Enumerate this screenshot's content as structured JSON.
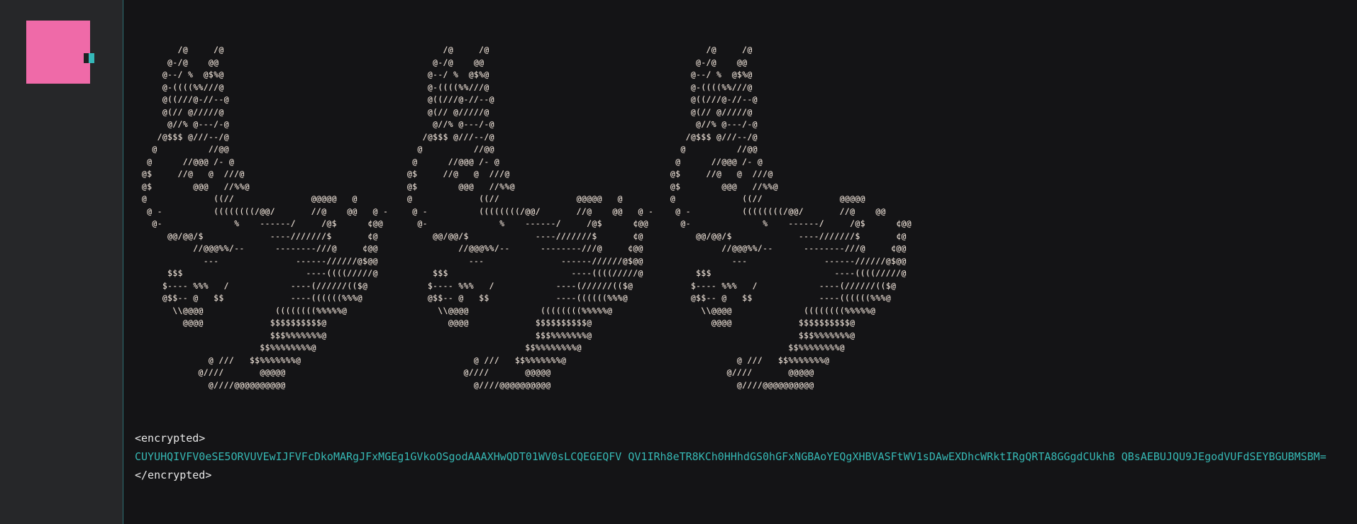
{
  "sidebar": {
    "avatar_color": "#ef6aa8",
    "accent_color": "#35b8b8"
  },
  "art": {
    "copies": [
      "       /@     /@\n     @-/@    @@\n    @--/ %  @$%@\n    @-((((%%///@\n    @((///@-//--@\n    @(// @/////@\n     @//% @---/-@\n   /@$$$ @///--/@\n  @          //@@\n @      //@@@ /- @\n@$     //@   @  ///@\n@$        @@@   //%%@\n@             ((//               @@@@@   @\n @ -          ((((((((/@@/       //@    @@   @ -\n  @-              %    ------/     /@$      ¢@@\n     @@/@@/$             ----///////$       ¢@\n          //@@@%%/--      --------///@     ¢@@\n            ---               ------//////@$@@\n     $$$                        ----((((/////@\n    $---- %%%   /            ----(//////(($@\n    @$$-- @   $$             ----((((((%%%@\n      \\\\@@@@              ((((((((%%%%%@\n        @@@@             $$$$$$$$$$@\n                         $$$%%%%%%%@\n                       $$%%%%%%%%@\n             @ ///   $$%%%%%%%@\n           @////       @@@@@\n             @////@@@@@@@@@@",
      "       /@     /@\n     @-/@    @@\n    @--/ %  @$%@\n    @-((((%%///@\n    @((///@-//--@\n    @(// @/////@\n     @//% @---/-@\n   /@$$$ @///--/@\n  @          //@@\n @      //@@@ /- @\n@$     //@   @  ///@\n@$        @@@   //%%@\n@             ((//               @@@@@   @\n @ -          ((((((((/@@/       //@    @@   @ -\n  @-              %    ------/     /@$      ¢@@\n     @@/@@/$             ----///////$       ¢@\n          //@@@%%/--      --------///@     ¢@@\n            ---               ------//////@$@@\n     $$$                        ----((((/////@\n    $---- %%%   /            ----(//////(($@\n    @$$-- @   $$             ----((((((%%%@\n      \\\\@@@@              ((((((((%%%%%@\n        @@@@             $$$$$$$$$$@\n                         $$$%%%%%%%@\n                       $$%%%%%%%%@\n             @ ///   $$%%%%%%%@\n           @////       @@@@@\n             @////@@@@@@@@@@",
      "       /@     /@\n     @-/@    @@\n    @--/ %  @$%@\n    @-((((%%///@\n    @((///@-//--@\n    @(// @/////@\n     @//% @---/-@\n   /@$$$ @///--/@\n  @          //@@\n @      //@@@ /- @\n@$     //@   @  ///@\n@$        @@@   //%%@\n@             ((//               @@@@@\n @ -          ((((((((/@@/       //@    @@\n  @-              %    ------/     /@$      ¢@@\n     @@/@@/$             ----///////$       ¢@\n          //@@@%%/--      --------///@     ¢@@\n            ---               ------//////@$@@\n     $$$                        ----((((/////@\n    $---- %%%   /            ----(//////(($@\n    @$$-- @   $$             ----((((((%%%@\n      \\\\@@@@              ((((((((%%%%%@\n        @@@@             $$$$$$$$$$@\n                         $$$%%%%%%%@\n                       $$%%%%%%%%@\n             @ ///   $$%%%%%%%@\n           @////       @@@@@\n             @////@@@@@@@@@@"
    ]
  },
  "output": {
    "open_tag": "<encrypted>",
    "payload": "CUYUHQIVFV0eSE5ORVUVEwIJFVFcDkoMARgJFxMGEg1GVkoOSgodAAAXHwQDT01WV0sLCQEGEQFV QV1IRh8eTR8KCh0HHhdGS0hGFxNGBAoYEQgXHBVASFtWV1sDAwEXDhcWRktIRgQRTA8GGgdCUkhB QBsAEBUJQU9JEgodVUFdSEYBGUBMSBM=",
    "close_tag": "</encrypted>",
    "payload_color": "#36b8b4"
  }
}
